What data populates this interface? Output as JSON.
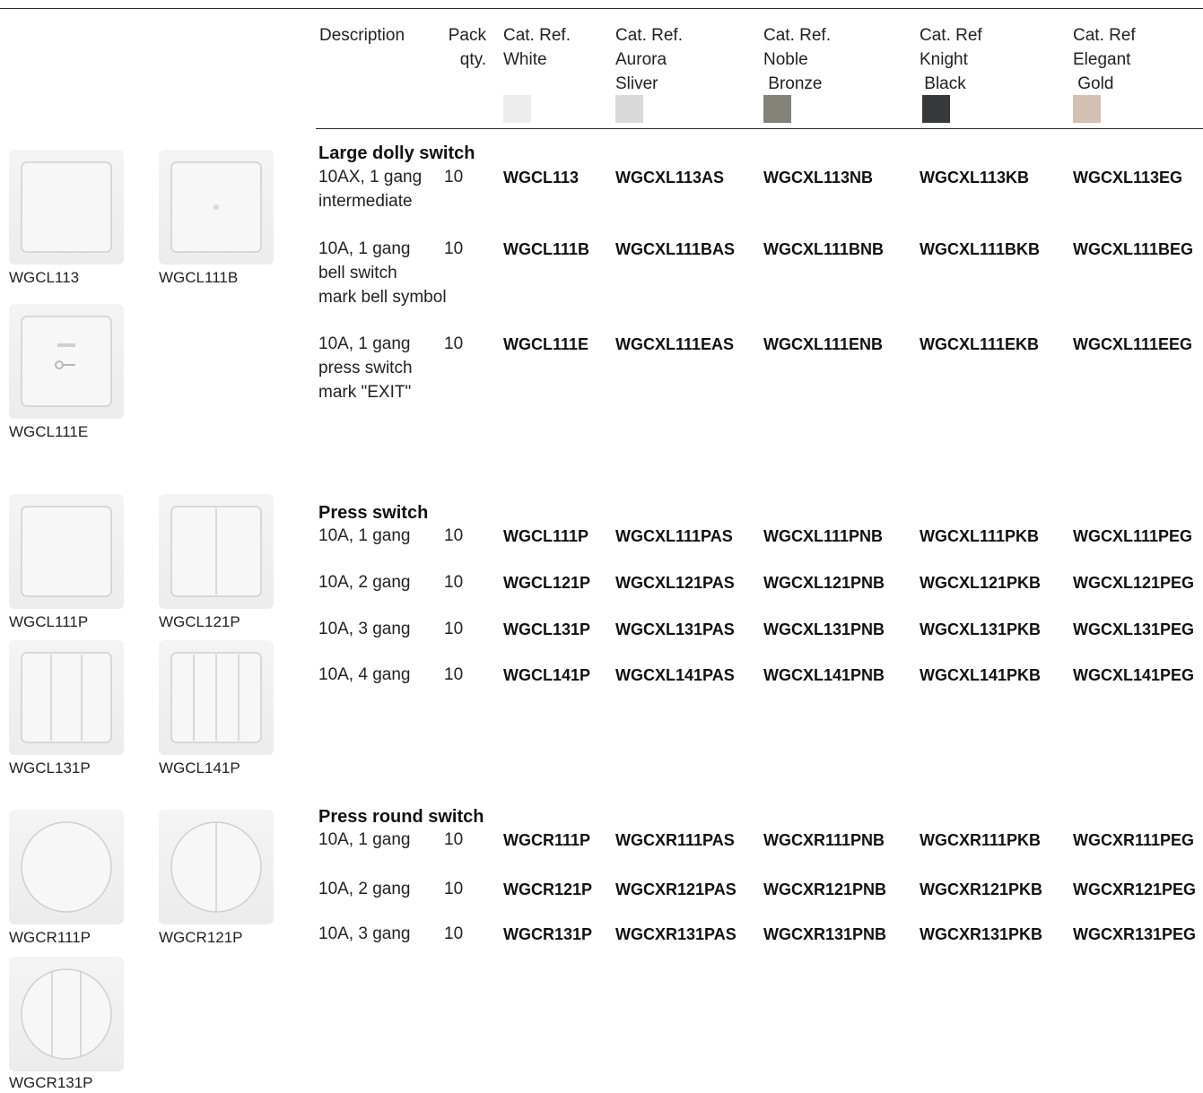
{
  "header": {
    "description": "Description",
    "pack_qty": [
      "Pack",
      "qty."
    ],
    "columns": [
      {
        "lines": [
          "Cat. Ref.",
          "White"
        ],
        "swatch": "#ededed"
      },
      {
        "lines": [
          "Cat. Ref.",
          "Aurora",
          "Sliver"
        ],
        "swatch": "#d9d9d9"
      },
      {
        "lines": [
          "Cat. Ref.",
          "Noble",
          " Bronze"
        ],
        "swatch": "#838279"
      },
      {
        "lines": [
          "Cat. Ref",
          "Knight",
          " Black"
        ],
        "swatch": "#363a3d"
      },
      {
        "lines": [
          "Cat. Ref",
          "Elegant",
          " Gold"
        ],
        "swatch": "#d3c0b3"
      }
    ]
  },
  "sections": [
    {
      "title": "Large dolly switch",
      "rows": [
        {
          "desc": [
            "10AX, 1 gang",
            "intermediate"
          ],
          "qty": "10",
          "refs": [
            "WGCL113",
            "WGCXL113AS",
            "WGCXL113NB",
            "WGCXL113KB",
            "WGCXL113EG"
          ]
        },
        {
          "desc": [
            "10A, 1 gang",
            "bell switch",
            "mark bell symbol"
          ],
          "qty": "10",
          "refs": [
            "WGCL111B",
            "WGCXL111BAS",
            "WGCXL111BNB",
            "WGCXL111BKB",
            "WGCXL111BEG"
          ]
        },
        {
          "desc": [
            "10A, 1 gang",
            "press switch",
            "mark \"EXIT\""
          ],
          "qty": "10",
          "refs": [
            "WGCL111E",
            "WGCXL111EAS",
            "WGCXL111ENB",
            "WGCXL111EKB",
            "WGCXL111EEG"
          ]
        }
      ]
    },
    {
      "title": "Press switch",
      "rows": [
        {
          "desc": [
            "10A, 1 gang"
          ],
          "qty": "10",
          "refs": [
            "WGCL111P",
            "WGCXL111PAS",
            "WGCXL111PNB",
            "WGCXL111PKB",
            "WGCXL111PEG"
          ]
        },
        {
          "desc": [
            "10A, 2 gang"
          ],
          "qty": "10",
          "refs": [
            "WGCL121P",
            "WGCXL121PAS",
            "WGCXL121PNB",
            "WGCXL121PKB",
            "WGCXL121PEG"
          ]
        },
        {
          "desc": [
            "10A, 3 gang"
          ],
          "qty": "10",
          "refs": [
            "WGCL131P",
            "WGCXL131PAS",
            "WGCXL131PNB",
            "WGCXL131PKB",
            "WGCXL131PEG"
          ]
        },
        {
          "desc": [
            "10A, 4 gang"
          ],
          "qty": "10",
          "refs": [
            "WGCL141P",
            "WGCXL141PAS",
            "WGCXL141PNB",
            "WGCXL141PKB",
            "WGCXL141PEG"
          ]
        }
      ]
    },
    {
      "title": "Press round switch",
      "rows": [
        {
          "desc": [
            "10A, 1 gang"
          ],
          "qty": "10",
          "refs": [
            "WGCR111P",
            "WGCXR111PAS",
            "WGCXR111PNB",
            "WGCXR111PKB",
            "WGCXR111PEG"
          ]
        },
        {
          "desc": [
            "10A, 2 gang"
          ],
          "qty": "10",
          "refs": [
            "WGCR121P",
            "WGCXR121PAS",
            "WGCXR121PNB",
            "WGCXR121PKB",
            "WGCXR121PEG"
          ]
        },
        {
          "desc": [
            "10A, 3 gang"
          ],
          "qty": "10",
          "refs": [
            "WGCR131P",
            "WGCXR131PAS",
            "WGCXR131PNB",
            "WGCXR131PKB",
            "WGCXR131PEG"
          ]
        }
      ]
    }
  ],
  "products": [
    {
      "caption": "WGCL113",
      "icon": "square-dolly-switch-icon"
    },
    {
      "caption": "WGCL111B",
      "icon": "square-bell-switch-icon"
    },
    {
      "caption": "WGCL111E",
      "icon": "exit-switch-icon"
    },
    {
      "caption": "WGCL111P",
      "icon": "press-1-gang-icon"
    },
    {
      "caption": "WGCL121P",
      "icon": "press-2-gang-icon"
    },
    {
      "caption": "WGCL131P",
      "icon": "press-3-gang-icon"
    },
    {
      "caption": "WGCL141P",
      "icon": "press-4-gang-icon"
    },
    {
      "caption": "WGCR111P",
      "icon": "round-1-gang-icon"
    },
    {
      "caption": "WGCR121P",
      "icon": "round-2-gang-icon"
    },
    {
      "caption": "WGCR131P",
      "icon": "round-3-gang-icon"
    }
  ]
}
